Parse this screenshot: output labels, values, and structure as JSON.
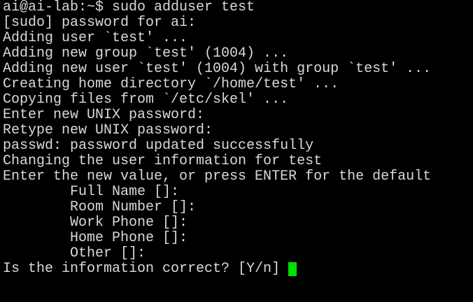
{
  "terminal": {
    "lines": [
      "ai@ai-lab:~$ sudo adduser test",
      "[sudo] password for ai:",
      "Adding user `test' ...",
      "Adding new group `test' (1004) ...",
      "Adding new user `test' (1004) with group `test' ...",
      "Creating home directory `/home/test' ...",
      "Copying files from `/etc/skel' ...",
      "Enter new UNIX password:",
      "Retype new UNIX password:",
      "passwd: password updated successfully",
      "Changing the user information for test",
      "Enter the new value, or press ENTER for the default"
    ],
    "fields": [
      "Full Name []:",
      "Room Number []:",
      "Work Phone []:",
      "Home Phone []:",
      "Other []:"
    ],
    "confirm_prompt": "Is the information correct? [Y/n]",
    "colors": {
      "background": "#000000",
      "text": "#d9d9d9",
      "cursor": "#00e000"
    }
  }
}
